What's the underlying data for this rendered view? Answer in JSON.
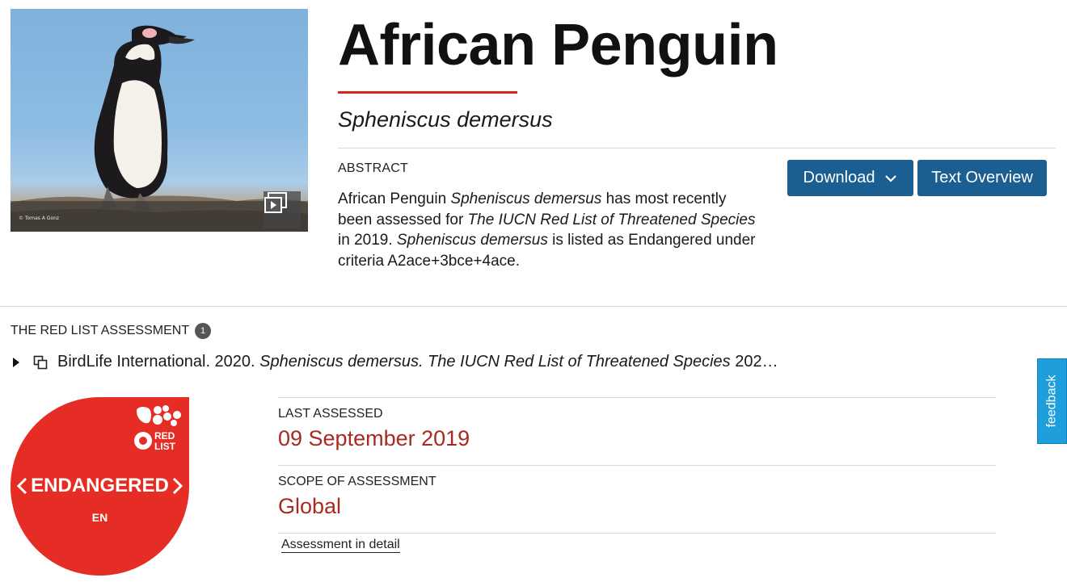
{
  "hero": {
    "photo_credit": "© Tomas A Gonz",
    "gallery_icon": "gallery-play-icon"
  },
  "species": {
    "common_name": "African Penguin",
    "scientific_name": "Spheniscus demersus"
  },
  "abstract": {
    "label": "ABSTRACT",
    "part1": "African Penguin ",
    "part2": "Spheniscus demersus",
    "part3": " has most recently been assessed for ",
    "part4": "The IUCN Red List of Threatened Species",
    "part5": " in 2019. ",
    "part6": "Spheniscus demersus",
    "part7": " is listed as Endangered under criteria A2ace+3bce+4ace."
  },
  "actions": {
    "download_label": "Download",
    "text_overview_label": "Text Overview"
  },
  "assessment": {
    "heading": "THE RED LIST ASSESSMENT",
    "count": "1",
    "citation_plain": "BirdLife International. 2020. ",
    "citation_italic": "Spheniscus demersus. The IUCN Red List of Threatened Species",
    "citation_tail": " 202…"
  },
  "status": {
    "label": "ENDANGERED",
    "code": "EN",
    "logo_text_1": "RED",
    "logo_text_2": "LIST",
    "color": "#e52d26"
  },
  "details": {
    "last_assessed_label": "LAST ASSESSED",
    "last_assessed_value": "09 September 2019",
    "scope_label": "SCOPE OF ASSESSMENT",
    "scope_value": "Global",
    "detail_link": "Assessment in detail"
  },
  "feedback": {
    "label": "feedback"
  },
  "colors": {
    "button_blue": "#1b5e91",
    "accent_red": "#d7251a",
    "value_red": "#a82a22",
    "feedback_blue": "#1e9fdc"
  }
}
